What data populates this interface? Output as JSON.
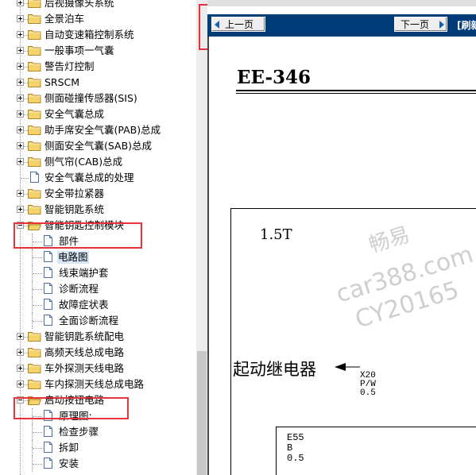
{
  "tree": {
    "items": [
      {
        "label": "后视摄像头系统",
        "type": "folder",
        "expander": "plus"
      },
      {
        "label": "全景泊车",
        "type": "folder",
        "expander": "plus"
      },
      {
        "label": "自动变速箱控制系统",
        "type": "folder",
        "expander": "plus"
      },
      {
        "label": "一般事项一气囊",
        "type": "folder",
        "expander": "plus"
      },
      {
        "label": "警告灯控制",
        "type": "folder",
        "expander": "plus"
      },
      {
        "label": "SRSCM",
        "type": "folder",
        "expander": "plus"
      },
      {
        "label": "侧面碰撞传感器(SIS)",
        "type": "folder",
        "expander": "plus"
      },
      {
        "label": "安全气囊总成",
        "type": "folder",
        "expander": "plus"
      },
      {
        "label": "助手席安全气囊(PAB)总成",
        "type": "folder",
        "expander": "plus"
      },
      {
        "label": "侧面安全气囊(SAB)总成",
        "type": "folder",
        "expander": "plus"
      },
      {
        "label": "侧气帘(CAB)总成",
        "type": "folder",
        "expander": "plus"
      },
      {
        "label": "安全气囊总成的处理",
        "type": "page"
      },
      {
        "label": "安全带拉紧器",
        "type": "folder",
        "expander": "plus"
      },
      {
        "label": "智能钥匙系统",
        "type": "folder",
        "expander": "plus"
      },
      {
        "label": "智能钥匙控制模块",
        "type": "folder-open",
        "expander": "minus"
      },
      {
        "label": "部件",
        "type": "page",
        "child": true
      },
      {
        "label": "电路图",
        "type": "page",
        "child": true,
        "selected": true
      },
      {
        "label": "线束端护套",
        "type": "page",
        "child": true
      },
      {
        "label": "诊断流程",
        "type": "page",
        "child": true
      },
      {
        "label": "故障症状表",
        "type": "page",
        "child": true
      },
      {
        "label": "全面诊断流程",
        "type": "page",
        "child": true
      },
      {
        "label": "智能钥匙系统配电",
        "type": "folder",
        "expander": "plus"
      },
      {
        "label": "高频天线总成电路",
        "type": "folder",
        "expander": "plus"
      },
      {
        "label": "车外探测天线电路",
        "type": "folder",
        "expander": "plus"
      },
      {
        "label": "车内探测天线总成电路",
        "type": "folder",
        "expander": "plus"
      },
      {
        "label": "启动按钮电路",
        "type": "folder-open",
        "expander": "minus"
      },
      {
        "label": "原理图:",
        "type": "page",
        "child": true
      },
      {
        "label": "检查步骤",
        "type": "page",
        "child": true
      },
      {
        "label": "拆卸",
        "type": "page",
        "child": true
      },
      {
        "label": "安装",
        "type": "page",
        "child": true
      }
    ]
  },
  "navbar": {
    "prev_label": "上一页",
    "next_label": "下一页",
    "refresh_label": "[刷新"
  },
  "document": {
    "code": "EE-346",
    "model": "1.5T",
    "relay_label": "起动继电器",
    "wire_1": [
      "X20",
      "P/W",
      "0.5"
    ],
    "wire_2": [
      "E55",
      "B",
      "0.5"
    ]
  },
  "watermark": {
    "line1": "畅易",
    "line2": "car388.com",
    "line3": "CY20165"
  },
  "colors": {
    "navbar_bg": "#003c78",
    "highlight_box": "#e8323a",
    "selection_bg": "#d7e6f7",
    "folder": "#f5d36b"
  }
}
